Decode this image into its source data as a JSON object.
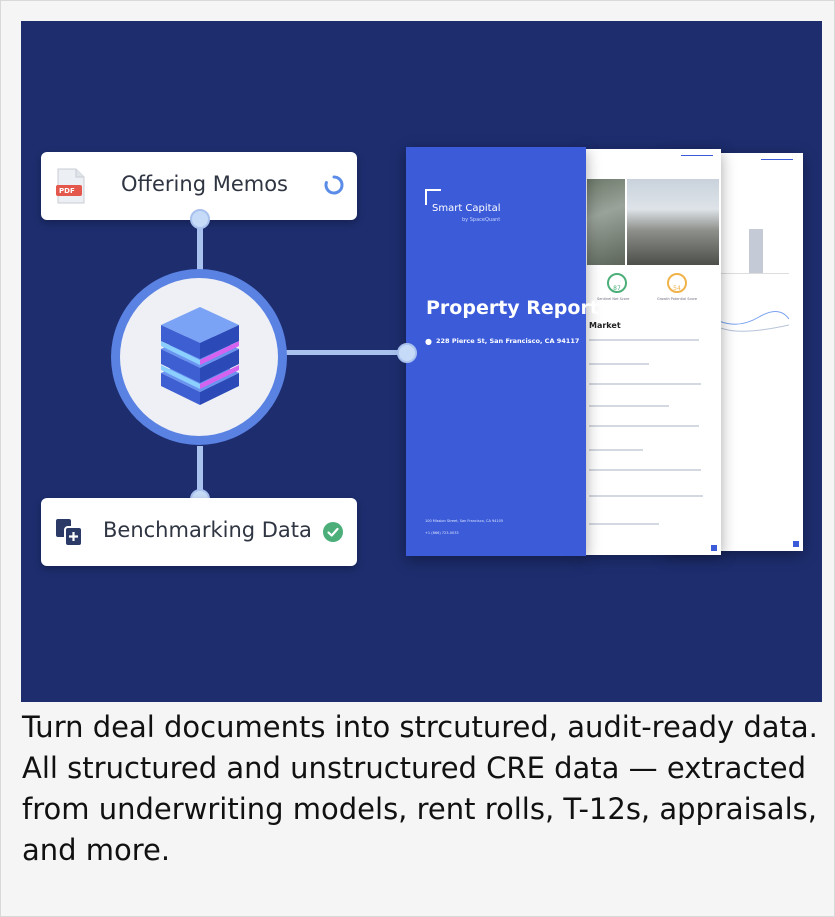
{
  "hero": {
    "offering_memos_label": "Offering Memos",
    "pdf_badge": "PDF",
    "benchmarking_label": "Benchmarking Data",
    "report": {
      "brand": "Smart Capital",
      "brand_sub": "by SpaceQuant",
      "title": "Property Report",
      "address": "228 Pierce St, San Francisco, CA 94117",
      "office_address": "100 Mission Street, San Francisco, CA 94105",
      "phone": "+1 (866) 723-0033"
    },
    "page2": {
      "section": "Market",
      "score_1": "87",
      "score_1_label": "Sentinel Net Score",
      "score_2": "54",
      "score_2_label": "Growth Potential Score"
    }
  },
  "caption": "Turn deal documents into strcutured, audit-ready data. All structured and unstructured CRE data — extracted from underwriting models, rent rolls, T-12s, appraisals, and more.",
  "colors": {
    "hero_bg": "#1d2d6e",
    "report_cover": "#3b5bd9",
    "accent_green": "#4caf7a",
    "accent_line": "#a9c1ef"
  }
}
